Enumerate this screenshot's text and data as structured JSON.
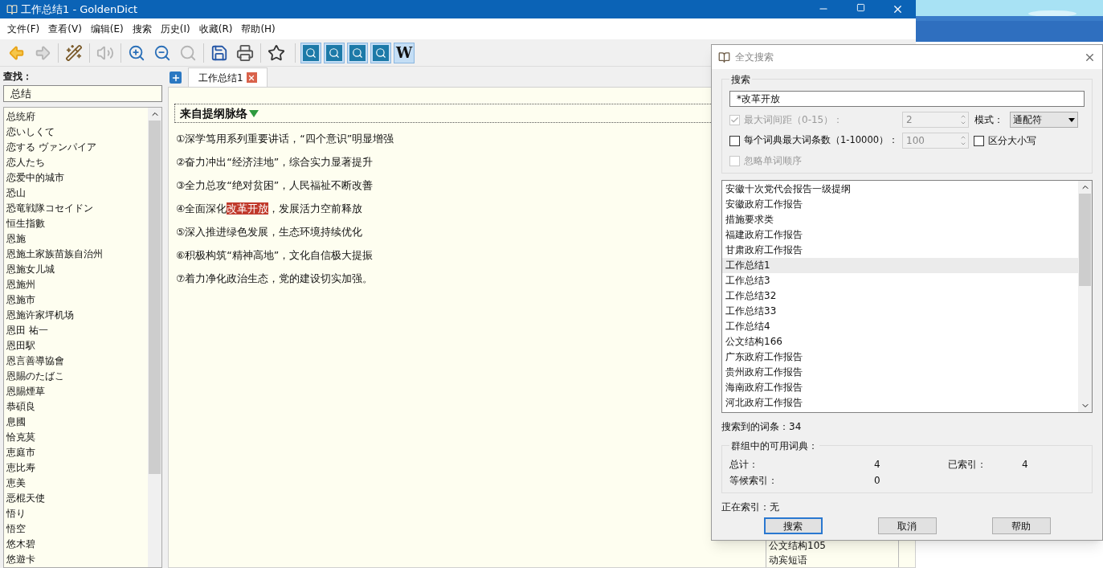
{
  "window": {
    "title": "工作总结1 - GoldenDict"
  },
  "menu": [
    "文件(F)",
    "查看(V)",
    "编辑(E)",
    "搜索",
    "历史(I)",
    "收藏(R)",
    "帮助(H)"
  ],
  "toolbar": [
    {
      "kind": "back",
      "disabled": false
    },
    {
      "kind": "forward",
      "disabled": true
    },
    {
      "kind": "wand",
      "disabled": false
    },
    {
      "kind": "speaker",
      "disabled": true
    },
    {
      "kind": "zoom-in",
      "disabled": false
    },
    {
      "kind": "zoom-out",
      "disabled": false
    },
    {
      "kind": "zoom-reset",
      "disabled": true
    },
    {
      "kind": "save",
      "disabled": false
    },
    {
      "kind": "print",
      "disabled": false
    },
    {
      "kind": "star",
      "disabled": false
    }
  ],
  "dictionaries": [
    {
      "kind": "dict",
      "active": true
    },
    {
      "kind": "dict",
      "active": true
    },
    {
      "kind": "dict",
      "active": true
    },
    {
      "kind": "dict",
      "active": true
    },
    {
      "kind": "letter",
      "label": "W",
      "active": true
    }
  ],
  "search_pane": {
    "label": "查找：",
    "value": "总结",
    "items": [
      "总统府",
      "恋いしくて",
      "恋する ヴァンパイア",
      "恋人たち",
      "恋爱中的城市",
      "恐山",
      "恐竜戦隊コセイドン",
      "恒生指數",
      "恩施",
      "恩施土家族苗族自治州",
      "恩施女儿城",
      "恩施州",
      "恩施市",
      "恩施许家坪机场",
      "恩田 祐一",
      "恩田駅",
      "恩言善導協會",
      "恩賜のたばこ",
      "恩賜煙草",
      "恭碩良",
      "息國",
      "恰克莫",
      "恵庭市",
      "恵比寿",
      "恵美",
      "恶棍天使",
      "悟り",
      "悟空",
      "悠木碧",
      "悠遊卡"
    ]
  },
  "tabs": [
    {
      "label": "工作总结1",
      "selected": true
    }
  ],
  "article": {
    "heading": "来自提纲脉络",
    "lines": [
      [
        {
          "text": "①深学笃用系列重要讲话，“四个意识”明显增强",
          "highlight": false
        }
      ],
      [
        {
          "text": "②奋力冲出“经济洼地”，综合实力显著提升",
          "highlight": false
        }
      ],
      [
        {
          "text": "③全力总攻“绝对贫困”，人民福祉不断改善",
          "highlight": false
        }
      ],
      [
        {
          "text": "④全面深化",
          "highlight": false
        },
        {
          "text": "改革开放",
          "highlight": true
        },
        {
          "text": "，发展活力空前释放",
          "highlight": false
        }
      ],
      [
        {
          "text": "⑤深入推进绿色发展，生态环境持续优化",
          "highlight": false
        }
      ],
      [
        {
          "text": "⑥积极构筑“精神高地”，文化自信极大提振",
          "highlight": false
        }
      ],
      [
        {
          "text": "⑦着力净化政治生态，党的建设切实加强。",
          "highlight": false
        }
      ]
    ]
  },
  "side_panel": {
    "items": [
      "公文结构105",
      "动宾短语"
    ]
  },
  "dialog": {
    "title": "全文搜索",
    "group_title": "搜索",
    "query": "*改革开放",
    "max_distance": {
      "label": "最大词间距（0-15）：",
      "checked": true,
      "disabled": true,
      "value": "2"
    },
    "mode": {
      "label": "模式：",
      "value": "通配符"
    },
    "max_articles": {
      "label": "每个词典最大词条数（1-10000）：",
      "checked": false,
      "disabled": false,
      "value": "100"
    },
    "match_case": {
      "label": "区分大小写",
      "checked": false,
      "disabled": false
    },
    "ignore_order": {
      "label": "忽略单词顺序",
      "checked": false,
      "disabled": true
    },
    "results": [
      {
        "label": "安徽十次党代会报告一级提纲",
        "selected": false
      },
      {
        "label": "安徽政府工作报告",
        "selected": false
      },
      {
        "label": "措施要求类",
        "selected": false
      },
      {
        "label": "福建政府工作报告",
        "selected": false
      },
      {
        "label": "甘肃政府工作报告",
        "selected": false
      },
      {
        "label": "工作总结1",
        "selected": true
      },
      {
        "label": "工作总结3",
        "selected": false
      },
      {
        "label": "工作总结32",
        "selected": false
      },
      {
        "label": "工作总结33",
        "selected": false
      },
      {
        "label": "工作总结4",
        "selected": false
      },
      {
        "label": "公文结构166",
        "selected": false
      },
      {
        "label": "广东政府工作报告",
        "selected": false
      },
      {
        "label": "贵州政府工作报告",
        "selected": false
      },
      {
        "label": "海南政府工作报告",
        "selected": false
      },
      {
        "label": "河北政府工作报告",
        "selected": false
      }
    ],
    "found": "搜索到的词条：34",
    "stats": {
      "title": "群组中的可用词典：",
      "total_label": "总计：",
      "total": "4",
      "indexed_label": "已索引：",
      "indexed": "4",
      "pending_label": "等候索引：",
      "pending": "0"
    },
    "status": "正在索引：无",
    "buttons": [
      {
        "label": "搜索",
        "default": true
      },
      {
        "label": "取消",
        "default": false
      },
      {
        "label": "帮助",
        "default": false
      }
    ]
  }
}
